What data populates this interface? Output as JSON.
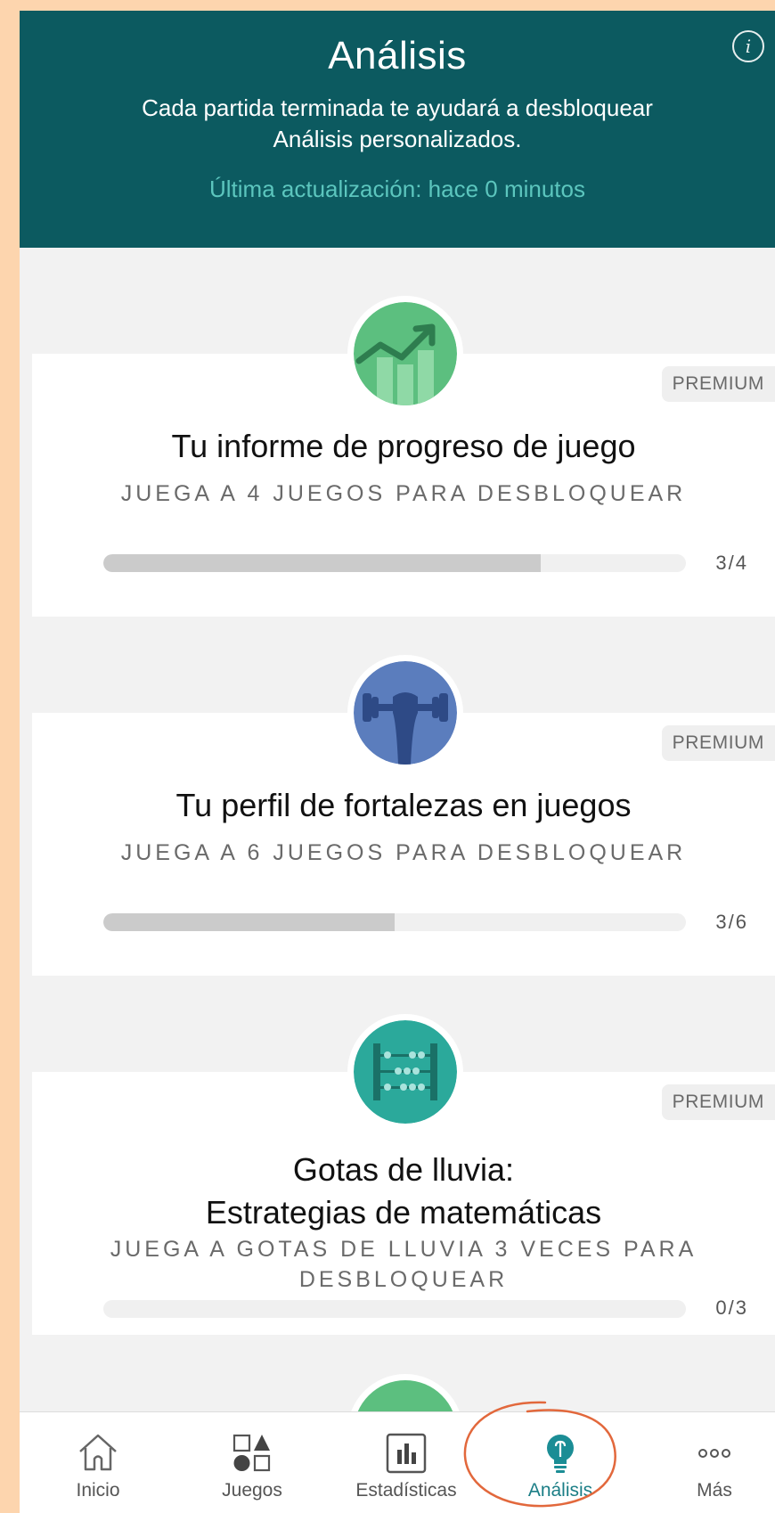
{
  "header": {
    "title": "Análisis",
    "subtitle": "Cada partida terminada te ayudará a desbloquear Análisis personalizados.",
    "updated": "Última actualización: hace 0 minutos",
    "info_icon": "info-icon"
  },
  "cards": [
    {
      "icon": "chart-growth-icon",
      "badge": "PREMIUM",
      "title": "Tu informe de progreso de juego",
      "subtitle": "JUEGA A 4 JUEGOS PARA DESBLOQUEAR",
      "progress": 0.75,
      "count": "3/4",
      "color": "#5CBF7F"
    },
    {
      "icon": "dumbbell-icon",
      "badge": "PREMIUM",
      "title": "Tu perfil de fortalezas en juegos",
      "subtitle": "JUEGA A 6 JUEGOS PARA DESBLOQUEAR",
      "progress": 0.5,
      "count": "3/6",
      "color": "#5B7DBD"
    },
    {
      "icon": "abacus-icon",
      "badge": "PREMIUM",
      "title_line1": "Gotas de lluvia:",
      "title_line2": "Estrategias de matemáticas",
      "subtitle_line1": "JUEGA A GOTAS DE LLUVIA 3 VECES PARA",
      "subtitle_line2": "DESBLOQUEAR",
      "progress": 0,
      "count": "0/3",
      "color": "#2BA99B"
    }
  ],
  "nav": {
    "items": [
      {
        "label": "Inicio",
        "icon": "home-icon"
      },
      {
        "label": "Juegos",
        "icon": "shapes-icon"
      },
      {
        "label": "Estadísticas",
        "icon": "bar-chart-icon"
      },
      {
        "label": "Análisis",
        "icon": "lightbulb-icon",
        "active": true
      },
      {
        "label": "Más",
        "icon": "more-icon"
      }
    ]
  },
  "colors": {
    "header_bg": "#0C5A60",
    "accent": "#1B7E86",
    "annotation": "#E2683C",
    "frame": "#FDD5AE"
  }
}
